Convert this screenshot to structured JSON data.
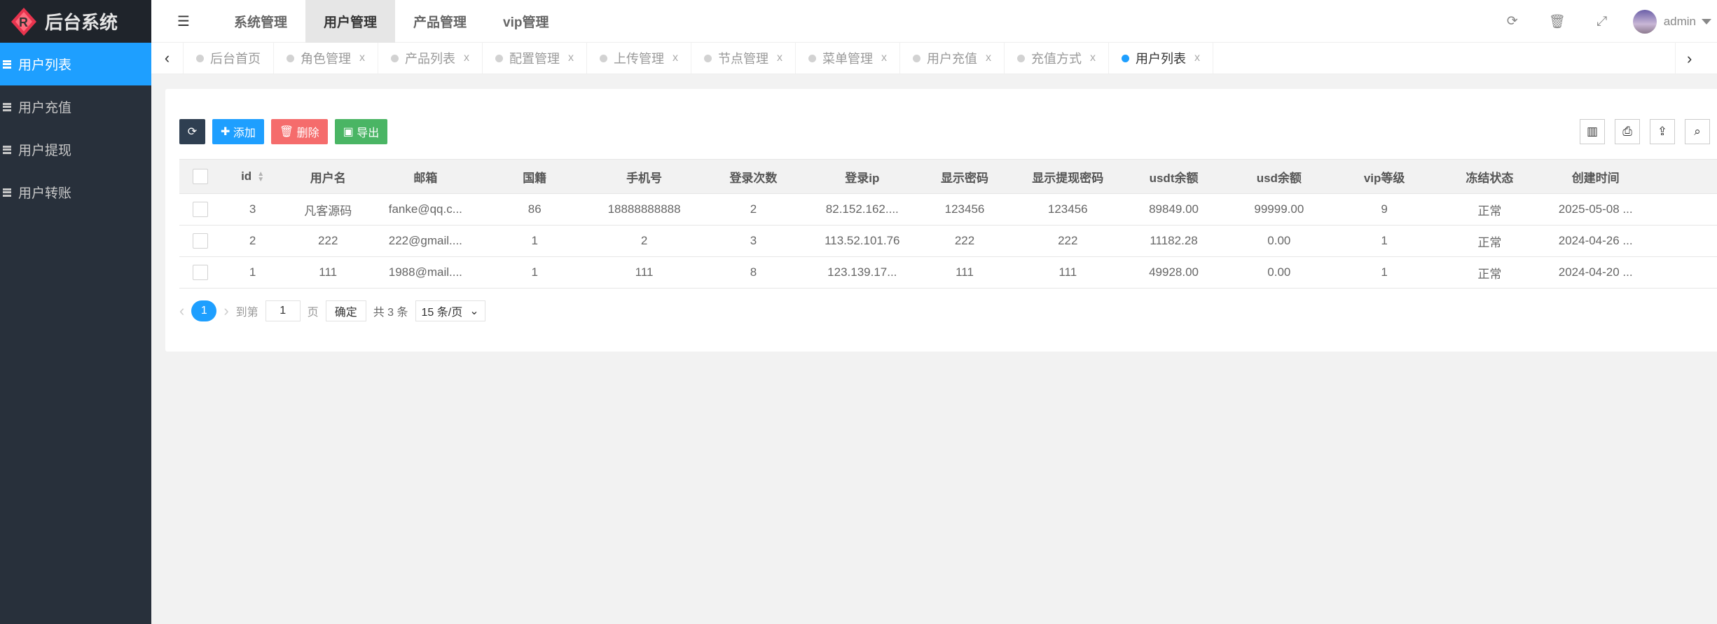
{
  "app": {
    "title": "后台系统",
    "accent": "#1e9fff"
  },
  "sidebar": {
    "items": [
      {
        "label": "用户列表",
        "active": true
      },
      {
        "label": "用户充值"
      },
      {
        "label": "用户提现"
      },
      {
        "label": "用户转账"
      }
    ]
  },
  "header": {
    "nav": [
      {
        "label": "系统管理"
      },
      {
        "label": "用户管理",
        "active": true
      },
      {
        "label": "产品管理"
      },
      {
        "label": "vip管理"
      }
    ],
    "user": "admin",
    "icons": [
      "refresh-icon",
      "trash-icon",
      "fullscreen-icon"
    ]
  },
  "tabs": [
    {
      "label": "后台首页",
      "closable": false
    },
    {
      "label": "角色管理"
    },
    {
      "label": "产品列表"
    },
    {
      "label": "配置管理"
    },
    {
      "label": "上传管理"
    },
    {
      "label": "节点管理"
    },
    {
      "label": "菜单管理"
    },
    {
      "label": "用户充值"
    },
    {
      "label": "充值方式"
    },
    {
      "label": "用户列表",
      "active": true
    }
  ],
  "tab_close": "x",
  "toolbar": {
    "add": "添加",
    "delete": "删除",
    "export": "导出"
  },
  "table": {
    "columns": [
      "id",
      "用户名",
      "邮箱",
      "国籍",
      "手机号",
      "登录次数",
      "登录ip",
      "显示密码",
      "显示提现密码",
      "usdt余额",
      "usd余额",
      "vip等级",
      "冻结状态",
      "创建时间"
    ],
    "rows": [
      [
        "3",
        "凡客源码",
        "fanke@qq.c...",
        "86",
        "18888888888",
        "2",
        "82.152.162....",
        "123456",
        "123456",
        "89849.00",
        "99999.00",
        "9",
        "正常",
        "2025-05-08 ..."
      ],
      [
        "2",
        "222",
        "222@gmail....",
        "1",
        "2",
        "3",
        "113.52.101.76",
        "222",
        "222",
        "11182.28",
        "0.00",
        "1",
        "正常",
        "2024-04-26 ..."
      ],
      [
        "1",
        "111",
        "1988@mail....",
        "1",
        "111",
        "8",
        "123.139.17...",
        "111",
        "111",
        "49928.00",
        "0.00",
        "1",
        "正常",
        "2024-04-20 ..."
      ]
    ]
  },
  "pager": {
    "current": "1",
    "goto": "到第",
    "page_input": "1",
    "page_unit": "页",
    "confirm": "确定",
    "total": "共 3 条",
    "per_page": "15 条/页"
  }
}
